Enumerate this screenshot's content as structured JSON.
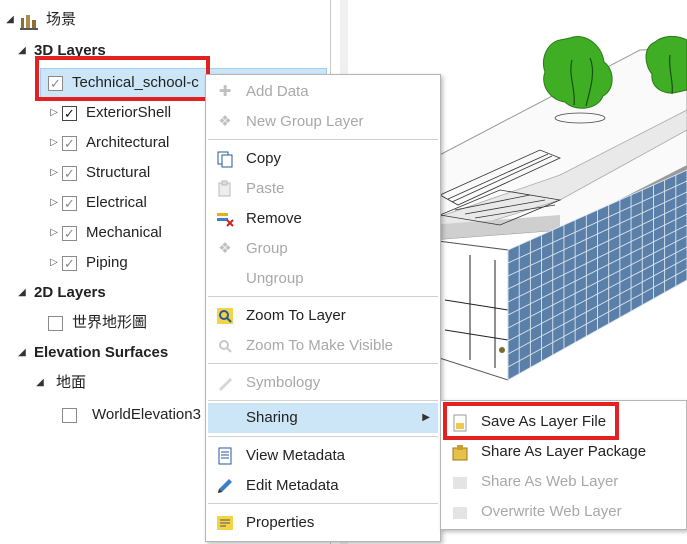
{
  "contents": {
    "map_name": "场景",
    "groups": {
      "layers3d": "3D Layers",
      "layers2d": "2D Layers",
      "elevation": "Elevation Surfaces"
    },
    "selected_layer": "Technical_school-c",
    "sublayers": [
      "ExteriorShell",
      "Architectural",
      "Structural",
      "Electrical",
      "Mechanical",
      "Piping"
    ],
    "layer_2d": "世界地形圖",
    "ground": "地面",
    "elevation_layer": "WorldElevation3"
  },
  "context_menu": {
    "add_data": "Add Data",
    "new_group_layer": "New Group Layer",
    "copy": "Copy",
    "paste": "Paste",
    "remove": "Remove",
    "group": "Group",
    "ungroup": "Ungroup",
    "zoom_to_layer": "Zoom To Layer",
    "zoom_to_make_visible": "Zoom To Make Visible",
    "symbology": "Symbology",
    "sharing": "Sharing",
    "view_metadata": "View Metadata",
    "edit_metadata": "Edit Metadata",
    "properties": "Properties"
  },
  "sharing_submenu": {
    "save_as_layer_file": "Save As Layer File",
    "share_as_layer_package": "Share As Layer Package",
    "share_as_web_layer": "Share As Web Layer",
    "overwrite_web_layer": "Overwrite Web Layer"
  },
  "colors": {
    "selection": "#cce6f7",
    "highlight_box": "#e32022",
    "building_glass": "#5a7fa8",
    "tree": "#3fae24"
  }
}
